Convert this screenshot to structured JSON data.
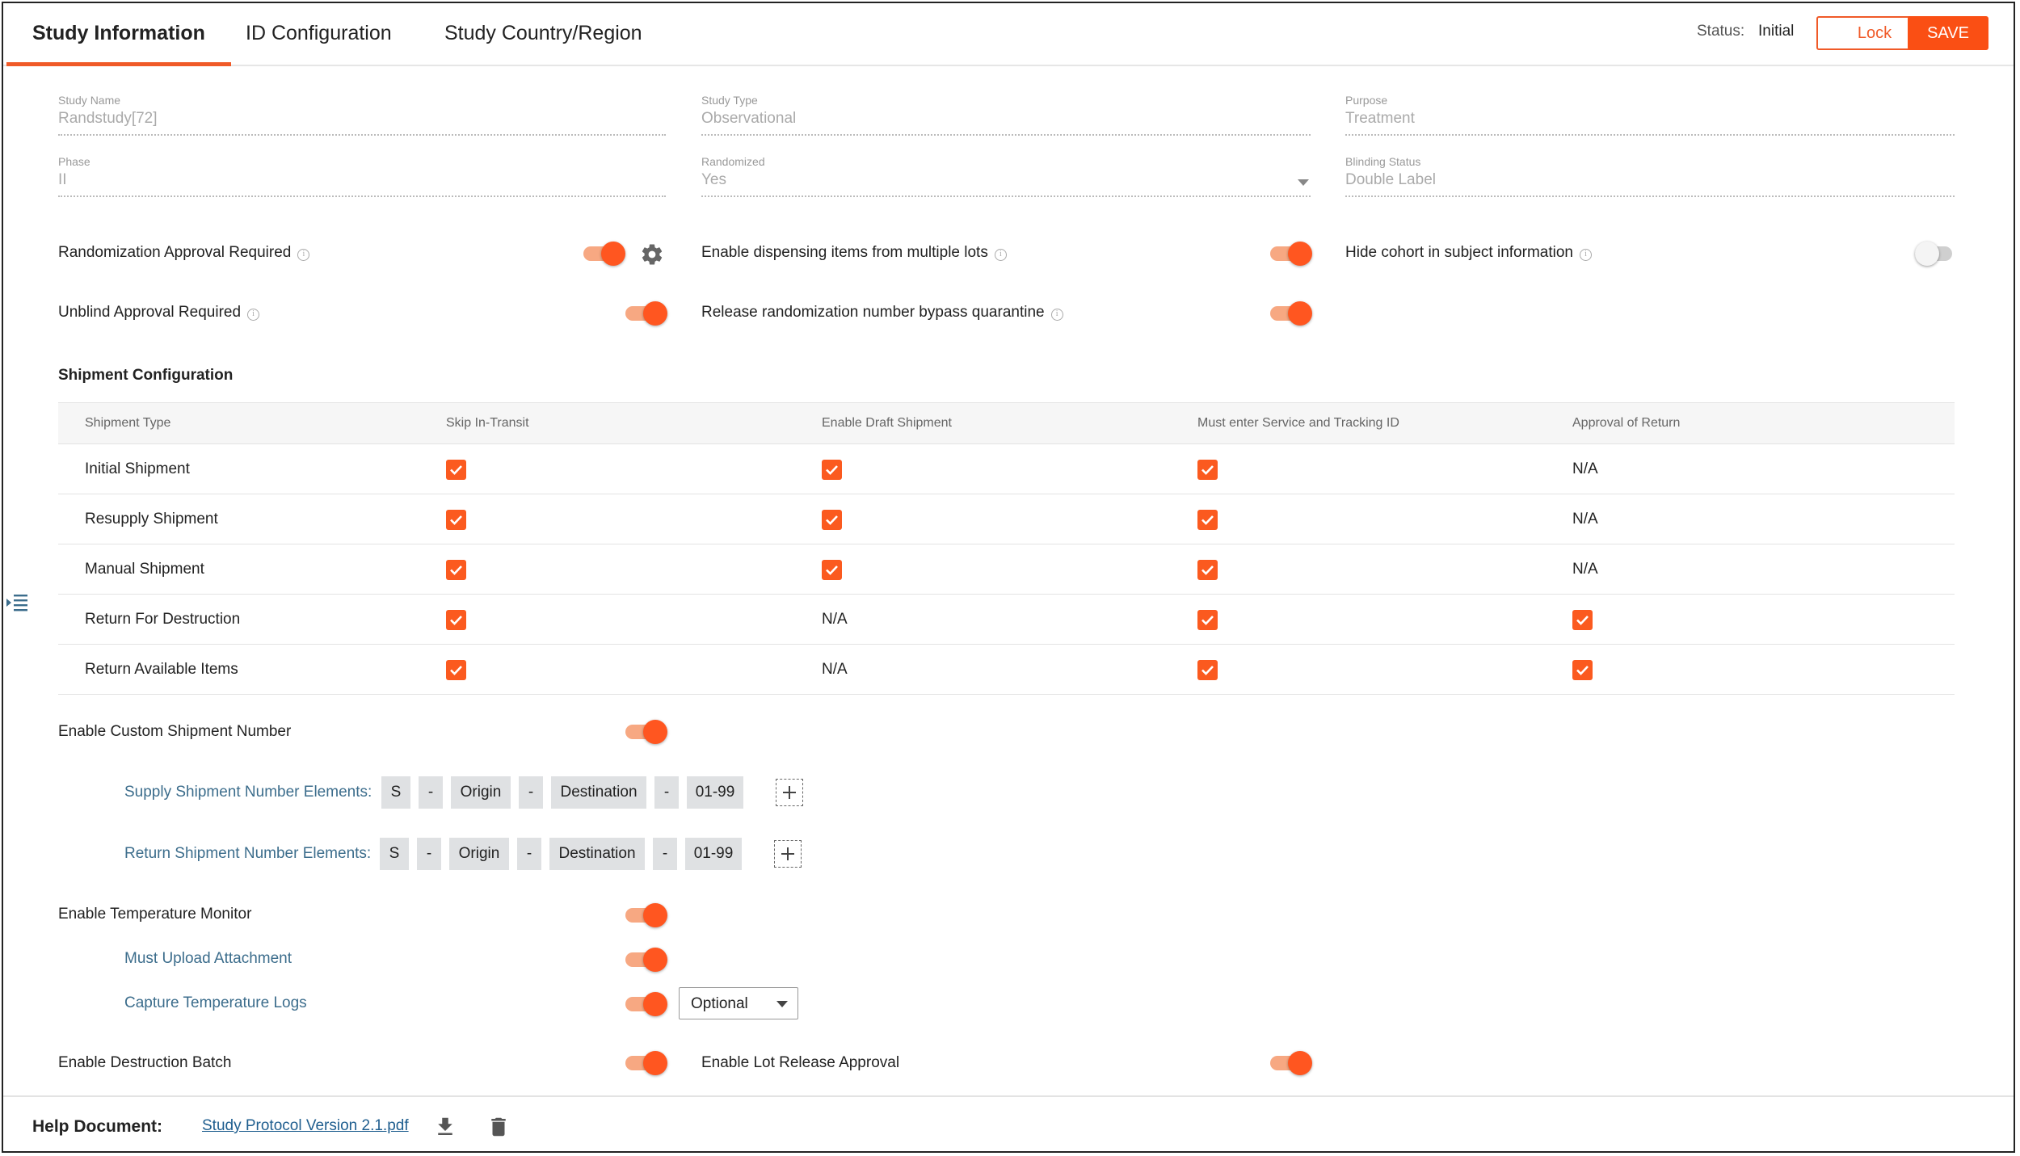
{
  "tabs": [
    {
      "label": "Study Information",
      "active": true
    },
    {
      "label": "ID Configuration",
      "active": false
    },
    {
      "label": "Study Country/Region",
      "active": false
    }
  ],
  "status": {
    "label": "Status:",
    "value": "Initial"
  },
  "buttons": {
    "lock": "Lock",
    "save": "SAVE"
  },
  "fields": {
    "study_name": {
      "label": "Study Name",
      "value": "Randstudy[72]"
    },
    "study_type": {
      "label": "Study Type",
      "value": "Observational"
    },
    "purpose": {
      "label": "Purpose",
      "value": "Treatment"
    },
    "phase": {
      "label": "Phase",
      "value": "II"
    },
    "randomized": {
      "label": "Randomized",
      "value": "Yes"
    },
    "blinding_status": {
      "label": "Blinding Status",
      "value": "Double Label"
    }
  },
  "toggles": {
    "randomization_approval": {
      "label": "Randomization Approval Required",
      "on": true
    },
    "dispensing_multiple_lots": {
      "label": "Enable dispensing items from multiple lots",
      "on": true
    },
    "hide_cohort": {
      "label": "Hide cohort in subject information",
      "on": false
    },
    "unblind_approval": {
      "label": "Unblind Approval Required",
      "on": true
    },
    "release_rand_bypass": {
      "label": "Release randomization number bypass quarantine",
      "on": true
    },
    "custom_shipment_number": {
      "label": "Enable Custom Shipment Number",
      "on": true
    },
    "temperature_monitor": {
      "label": "Enable Temperature Monitor",
      "on": true
    },
    "must_upload_attachment": {
      "label": "Must Upload Attachment",
      "on": true
    },
    "capture_temperature_logs": {
      "label": "Capture Temperature Logs",
      "on": true
    },
    "destruction_batch": {
      "label": "Enable Destruction Batch",
      "on": true
    },
    "lot_release_approval": {
      "label": "Enable Lot Release Approval",
      "on": true
    }
  },
  "shipment": {
    "title": "Shipment Configuration",
    "columns": [
      "Shipment Type",
      "Skip In-Transit",
      "Enable Draft Shipment",
      "Must enter Service and Tracking ID",
      "Approval of Return"
    ],
    "rows": [
      {
        "type": "Initial Shipment",
        "skip": "check",
        "draft": "check",
        "tracking": "check",
        "approval": "N/A"
      },
      {
        "type": "Resupply Shipment",
        "skip": "check",
        "draft": "check",
        "tracking": "check",
        "approval": "N/A"
      },
      {
        "type": "Manual Shipment",
        "skip": "check",
        "draft": "check",
        "tracking": "check",
        "approval": "N/A"
      },
      {
        "type": "Return For Destruction",
        "skip": "check",
        "draft": "N/A",
        "tracking": "check",
        "approval": "check"
      },
      {
        "type": "Return Available Items",
        "skip": "check",
        "draft": "N/A",
        "tracking": "check",
        "approval": "check"
      }
    ]
  },
  "supply_elements": {
    "label": "Supply Shipment Number Elements:",
    "chips": [
      "S",
      "-",
      "Origin",
      "-",
      "Destination",
      "-",
      "01-99"
    ]
  },
  "return_elements": {
    "label": "Return Shipment Number Elements:",
    "chips": [
      "S",
      "-",
      "Origin",
      "-",
      "Destination",
      "-",
      "01-99"
    ]
  },
  "capture_logs_select": {
    "value": "Optional"
  },
  "footer": {
    "help_label": "Help Document:",
    "doc_link": "Study Protocol Version 2.1.pdf"
  },
  "colors": {
    "accent": "#fa4f14",
    "link": "#1f5e8f",
    "sub_label": "#3c6d8c"
  },
  "icons": [
    "info-icon",
    "gear-icon",
    "checkbox-checked-icon",
    "add-element-icon",
    "download-icon",
    "trash-icon",
    "sidebar-toggle-icon",
    "chevron-down-icon"
  ]
}
